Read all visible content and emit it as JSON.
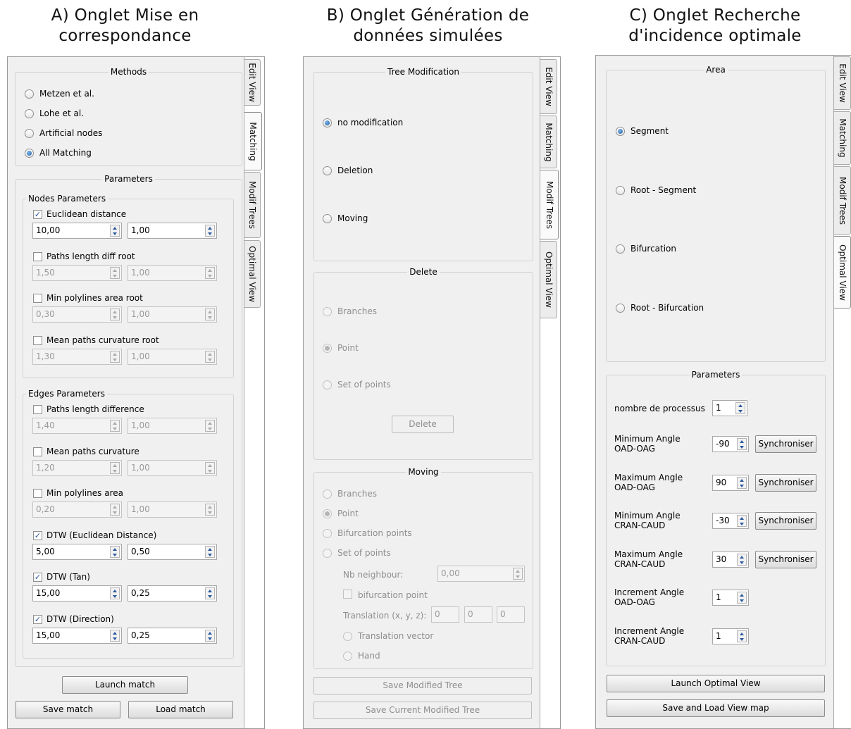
{
  "titles": {
    "a_line1": "A) Onglet Mise en",
    "a_line2": "correspondance",
    "b_line1": "B) Onglet Génération de",
    "b_line2": "données simulées",
    "c_line1": "C) Onglet Recherche",
    "c_line2": "d'incidence optimale"
  },
  "panel_a": {
    "tabs": [
      "Edit View",
      "Matching",
      "Modif Trees",
      "Optimal View"
    ],
    "selected_tab": "Matching",
    "methods": {
      "title": "Methods",
      "options": [
        "Metzen et al.",
        "Lohe et al.",
        "Artificial nodes",
        "All Matching"
      ],
      "selected": "All Matching"
    },
    "parameters": {
      "title": "Parameters",
      "nodes": {
        "title": "Nodes Parameters",
        "rows": [
          {
            "label": "Euclidean distance",
            "checked": true,
            "v1": "10,00",
            "v2": "1,00"
          },
          {
            "label": "Paths length diff root",
            "checked": false,
            "v1": "1,50",
            "v2": "1,00"
          },
          {
            "label": "Min polylines area root",
            "checked": false,
            "v1": "0,30",
            "v2": "1,00"
          },
          {
            "label": "Mean paths curvature root",
            "checked": false,
            "v1": "1,30",
            "v2": "1,00"
          }
        ]
      },
      "edges": {
        "title": "Edges Parameters",
        "rows": [
          {
            "label": "Paths length difference",
            "checked": false,
            "v1": "1,40",
            "v2": "1,00"
          },
          {
            "label": "Mean paths curvature",
            "checked": false,
            "v1": "1,20",
            "v2": "1,00"
          },
          {
            "label": "Min polylines area",
            "checked": false,
            "v1": "0,20",
            "v2": "1,00"
          },
          {
            "label": "DTW (Euclidean Distance)",
            "checked": true,
            "v1": "5,00",
            "v2": "0,50"
          },
          {
            "label": "DTW (Tan)",
            "checked": true,
            "v1": "15,00",
            "v2": "0,25"
          },
          {
            "label": "DTW (Direction)",
            "checked": true,
            "v1": "15,00",
            "v2": "0,25"
          }
        ]
      }
    },
    "buttons": {
      "launch": "Launch match",
      "save": "Save match",
      "load": "Load match"
    }
  },
  "panel_b": {
    "tabs": [
      "Edit View",
      "Matching",
      "Modif Trees",
      "Optimal View"
    ],
    "selected_tab": "Modif Trees",
    "tree_mod": {
      "title": "Tree Modification",
      "options": [
        "no modification",
        "Deletion",
        "Moving"
      ],
      "selected": "no modification"
    },
    "delete": {
      "title": "Delete",
      "options": [
        "Branches",
        "Point",
        "Set of points"
      ],
      "selected": "Point",
      "button": "Delete"
    },
    "moving": {
      "title": "Moving",
      "options": [
        "Branches",
        "Point",
        "Bifurcation points",
        "Set of points"
      ],
      "selected": "Point",
      "nb_neighbour_label": "Nb neighbour:",
      "nb_neighbour_value": "0,00",
      "bifurcation_point": "bifurcation point",
      "translation_label": "Translation (x, y, z):",
      "translation_values": [
        "0",
        "0",
        "0"
      ],
      "sub_options": [
        "Translation vector",
        "Hand"
      ]
    },
    "buttons": {
      "save_modified": "Save Modified Tree",
      "save_current": "Save Current Modified Tree"
    }
  },
  "panel_c": {
    "tabs": [
      "Edit View",
      "Matching",
      "Modif Trees",
      "Optimal View"
    ],
    "selected_tab": "Optimal View",
    "area": {
      "title": "Area",
      "options": [
        "Segment",
        "Root - Segment",
        "Bifurcation",
        "Root - Bifurcation"
      ],
      "selected": "Segment"
    },
    "parameters": {
      "title": "Parameters",
      "process_label": "nombre de processus",
      "process_value": "1",
      "rows": [
        {
          "line1": "Minimum Angle",
          "line2": "OAD-OAG",
          "value": "-90",
          "button": "Synchroniser"
        },
        {
          "line1": "Maximum Angle",
          "line2": "OAD-OAG",
          "value": "90",
          "button": "Synchroniser"
        },
        {
          "line1": "Minimum Angle",
          "line2": "CRAN-CAUD",
          "value": "-30",
          "button": "Synchroniser"
        },
        {
          "line1": "Maximum Angle",
          "line2": "CRAN-CAUD",
          "value": "30",
          "button": "Synchroniser"
        },
        {
          "line1": "Increment Angle",
          "line2": "OAD-OAG",
          "value": "1",
          "button": ""
        },
        {
          "line1": "Increment Angle",
          "line2": "CRAN-CAUD",
          "value": "1",
          "button": ""
        }
      ]
    },
    "buttons": {
      "launch": "Launch Optimal View",
      "save_load": "Save and Load View map"
    }
  }
}
